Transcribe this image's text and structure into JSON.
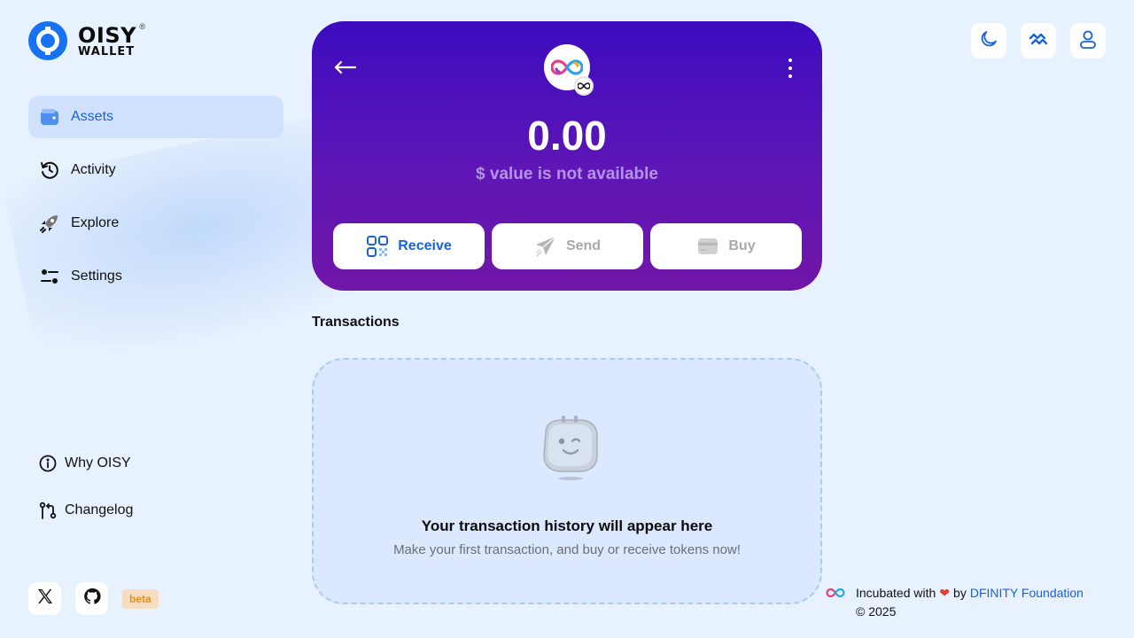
{
  "brand": {
    "word1": "OISY",
    "word2": "WALLET",
    "reg": "®"
  },
  "nav": {
    "items": [
      {
        "label": "Assets",
        "icon": "wallet-icon",
        "active": true
      },
      {
        "label": "Activity",
        "icon": "history-icon"
      },
      {
        "label": "Explore",
        "icon": "rocket-icon"
      },
      {
        "label": "Settings",
        "icon": "sliders-icon"
      }
    ],
    "bottom": [
      {
        "label": "Why OISY",
        "icon": "info-icon"
      },
      {
        "label": "Changelog",
        "icon": "git-compare-icon"
      }
    ],
    "beta": "beta"
  },
  "token": {
    "balance": "0.00",
    "usd_note": "$ value is not available"
  },
  "actions": {
    "receive": "Receive",
    "send": "Send",
    "buy": "Buy"
  },
  "transactions": {
    "heading": "Transactions",
    "empty_title": "Your transaction history will appear here",
    "empty_subtitle": "Make your first transaction, and buy or receive tokens now!"
  },
  "footer": {
    "incubated": "Incubated with",
    "by": "by",
    "link": "DFINITY Foundation",
    "copyright": "© 2025"
  },
  "colors": {
    "accent": "#1672f2",
    "hero_top": "#3c0cbf",
    "hero_bottom": "#7116a8",
    "background": "#e8f1fe"
  }
}
